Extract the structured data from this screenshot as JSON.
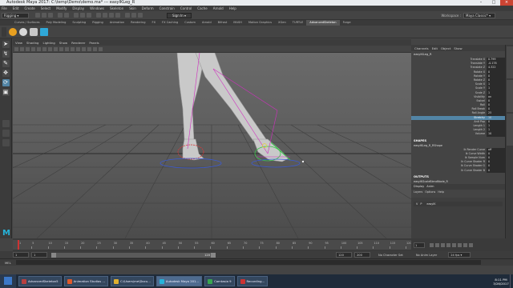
{
  "window": {
    "title": "Autodesk Maya 2017: C:\\temp\\Demo\\demo.ma* --- easyIKLeg_R"
  },
  "menubar": [
    "File",
    "Edit",
    "Create",
    "Select",
    "Modify",
    "Display",
    "Windows",
    "Skeleton",
    "Skin",
    "Deform",
    "Constrain",
    "Control",
    "Cache",
    "Arnold",
    "Help"
  ],
  "status": {
    "mode": "Rigging",
    "signin": "Sign In",
    "workspace_label": "Workspace :",
    "workspace_value": "Maya Classic*"
  },
  "shelf_tabs": [
    "Curves / Surfaces",
    "Poly Modeling",
    "Sculpting",
    "Rigging",
    "Animation",
    "Rendering",
    "FX",
    "FX Caching",
    "Custom",
    "Arnold",
    "Bifrost",
    "MASH",
    "Motion Graphics",
    "XGen",
    "TURTLE",
    "AdvancedSkeleton",
    "Forge"
  ],
  "shelf_active": "AdvancedSkeleton",
  "viewport_menu": [
    "View",
    "Shading",
    "Lighting",
    "Show",
    "Renderer",
    "Panels"
  ],
  "channel_tabs": [
    "Channels",
    "Edit",
    "Object",
    "Show"
  ],
  "channelbox": {
    "node": "easyIKLeg_R",
    "attrs": [
      {
        "n": "Translate X",
        "v": "0.799"
      },
      {
        "n": "Translate Y",
        "v": "-0.178"
      },
      {
        "n": "Translate Z",
        "v": "4.322"
      },
      {
        "n": "Rotate X",
        "v": "0"
      },
      {
        "n": "Rotate Y",
        "v": "0"
      },
      {
        "n": "Rotate Z",
        "v": "0"
      },
      {
        "n": "Scale X",
        "v": "1"
      },
      {
        "n": "Scale Y",
        "v": "1"
      },
      {
        "n": "Scale Z",
        "v": "1"
      },
      {
        "n": "Visibility",
        "v": "on"
      },
      {
        "n": "Swivel",
        "v": "0"
      },
      {
        "n": "Roll",
        "v": "0"
      },
      {
        "n": "Roll Break",
        "v": "0"
      },
      {
        "n": "Roll Angle",
        "v": "25"
      },
      {
        "n": "Stretchy",
        "v": "10"
      },
      {
        "n": "Anti Pop",
        "v": "0"
      },
      {
        "n": "Length 1",
        "v": "1"
      },
      {
        "n": "Length 2",
        "v": "1"
      },
      {
        "n": "Volume",
        "v": "10"
      }
    ],
    "highlight_index": 14,
    "shapes_header": "SHAPES",
    "shape_node": "easyIKLeg_R_RShape",
    "shape_attrs": [
      {
        "n": "Ik Render Curve",
        "v": "off"
      },
      {
        "n": "Ik Curve Width",
        "v": "0"
      },
      {
        "n": "Ik Sample Num",
        "v": "0"
      },
      {
        "n": "Ik Curve Shader R",
        "v": "0"
      },
      {
        "n": "Ik Curve Shader G",
        "v": "0"
      },
      {
        "n": "Ik Curve Shader B",
        "v": "0"
      }
    ],
    "outputs_header": "OUTPUTS",
    "output_node": "easyIKScaleBlendNode_R"
  },
  "layer_editor": {
    "tabs": [
      "Display",
      "Anim"
    ],
    "menu": [
      "Layers",
      "Options",
      "Help"
    ],
    "row": {
      "v": "V",
      "p": "P",
      "name": "easyIK"
    }
  },
  "timeline": {
    "ticks": [
      1,
      5,
      10,
      15,
      20,
      25,
      30,
      35,
      40,
      45,
      50,
      55,
      60,
      65,
      70,
      75,
      80,
      85,
      90,
      95,
      100,
      105,
      110,
      115,
      120
    ],
    "current_frame": "1"
  },
  "range": {
    "start": "1",
    "start2": "1",
    "end_inner": "120",
    "end": "120",
    "end2": "200",
    "char_set": "No Character Set",
    "anim_layer": "No Anim Layer",
    "fps": "24 fps"
  },
  "cmdline": {
    "label": "MEL"
  },
  "taskbar": {
    "tasks": [
      {
        "label": "AdvancedSkeleton5",
        "color": "#b84040"
      },
      {
        "label": "Animation Studios ...",
        "color": "#e05a2a"
      },
      {
        "label": "C:\\Users\\me\\Docu...",
        "color": "#e0b030"
      },
      {
        "label": "Autodesk Maya 201...",
        "color": "#26b3d9"
      },
      {
        "label": "Camtasia 9",
        "color": "#3aa650"
      },
      {
        "label": "Recording...",
        "color": "#cc3333"
      }
    ],
    "active_index": 3,
    "time": "8:11 PM",
    "date": "3/26/2017"
  },
  "colors": {
    "accent": "#5285a6",
    "pink": "#d02fbf",
    "red": "#d83a3a",
    "green": "#3ac44a",
    "blue": "#3a5ad8"
  }
}
